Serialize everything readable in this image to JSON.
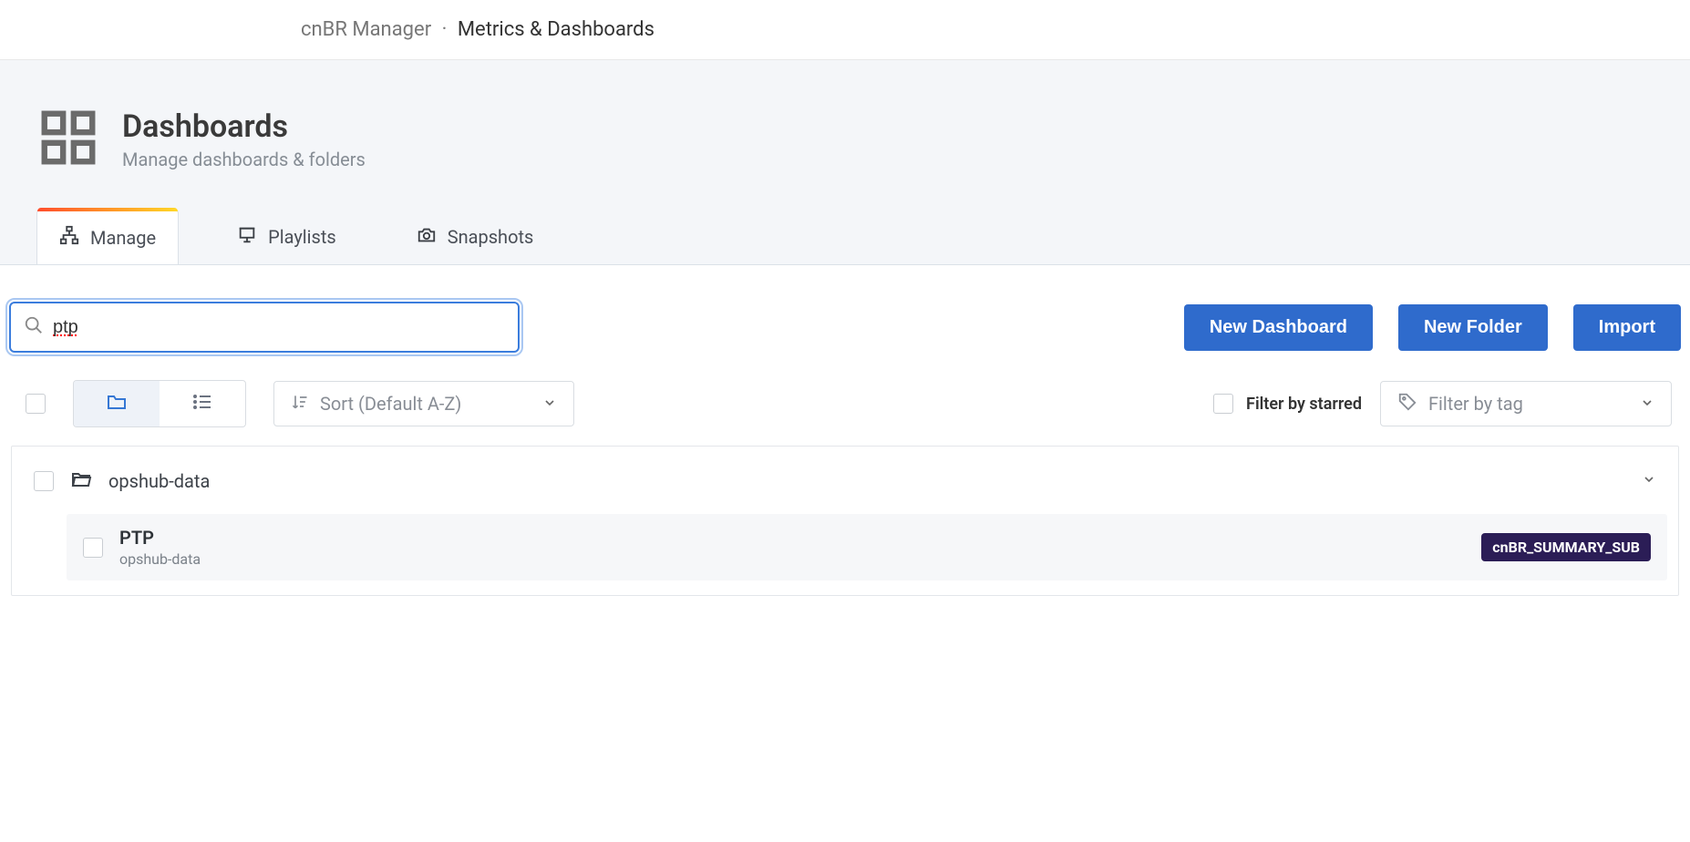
{
  "header": {
    "app_name": "cnBR Manager",
    "separator": "·",
    "section": "Metrics & Dashboards"
  },
  "page": {
    "title": "Dashboards",
    "subtitle": "Manage dashboards & folders"
  },
  "tabs": {
    "manage": "Manage",
    "playlists": "Playlists",
    "snapshots": "Snapshots"
  },
  "search": {
    "value": "ptp"
  },
  "actions": {
    "new_dashboard": "New Dashboard",
    "new_folder": "New Folder",
    "import": "Import"
  },
  "filters": {
    "sort_label": "Sort (Default A-Z)",
    "starred_label": "Filter by starred",
    "tag_placeholder": "Filter by tag"
  },
  "results": {
    "folder": {
      "name": "opshub-data"
    },
    "item": {
      "title": "PTP",
      "folder": "opshub-data",
      "badge": "cnBR_SUMMARY_SUB"
    }
  }
}
